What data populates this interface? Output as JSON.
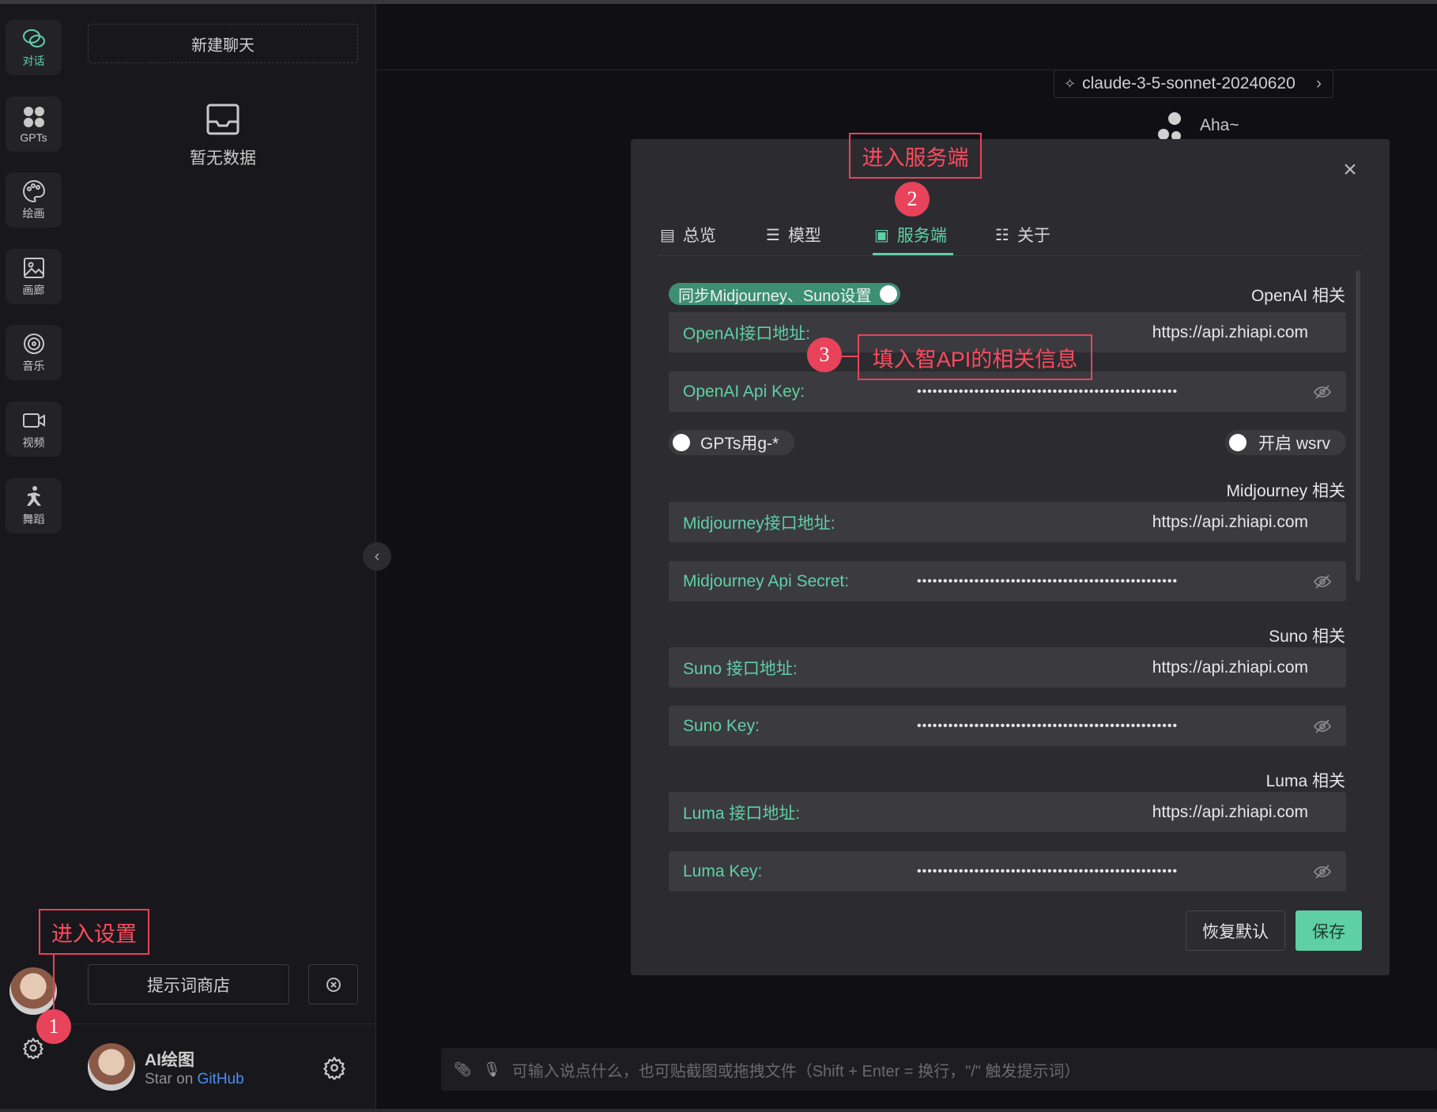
{
  "rail": {
    "items": [
      {
        "label": "对话",
        "icon": "chat-icon"
      },
      {
        "label": "GPTs",
        "icon": "grid-icon"
      },
      {
        "label": "绘画",
        "icon": "palette-icon"
      },
      {
        "label": "画廊",
        "icon": "image-icon"
      },
      {
        "label": "音乐",
        "icon": "music-icon"
      },
      {
        "label": "视频",
        "icon": "video-icon"
      },
      {
        "label": "舞蹈",
        "icon": "dance-icon"
      }
    ]
  },
  "chatlist": {
    "new_chat": "新建聊天",
    "empty_text": "暂无数据",
    "prompt_store": "提示词商店"
  },
  "user": {
    "name": "AI绘图",
    "star_prefix": "Star on",
    "star_link": "GitHub"
  },
  "header": {
    "model": "claude-3-5-sonnet-20240620",
    "assistant_name": "Aha~"
  },
  "input": {
    "placeholder": "可输入说点什么，也可贴截图或拖拽文件（Shift + Enter = 换行，\"/\" 触发提示词）"
  },
  "settings": {
    "tabs": [
      {
        "label": "总览"
      },
      {
        "label": "模型"
      },
      {
        "label": "服务端"
      },
      {
        "label": "关于"
      }
    ],
    "active_tab": "服务端",
    "sync_toggle": "同步Midjourney、Suno设置",
    "gpts_toggle": "GPTs用g-*",
    "wsrv_toggle": "开启 wsrv",
    "sections": {
      "openai": "OpenAI 相关",
      "midjourney": "Midjourney 相关",
      "suno": "Suno 相关",
      "luma": "Luma 相关"
    },
    "fields": {
      "openai_url_label": "OpenAI接口地址:",
      "openai_url_value": "https://api.zhiapi.com",
      "openai_key_label": "OpenAI Api Key:",
      "mj_url_label": "Midjourney接口地址:",
      "mj_url_value": "https://api.zhiapi.com",
      "mj_secret_label": "Midjourney Api Secret:",
      "suno_url_label": "Suno 接口地址:",
      "suno_url_value": "https://api.zhiapi.com",
      "suno_key_label": "Suno Key:",
      "luma_url_label": "Luma 接口地址:",
      "luma_url_value": "https://api.zhiapi.com",
      "luma_key_label": "Luma Key:",
      "masked": "••••••••••••••••••••••••••••••••••••••••••••••••••"
    },
    "reset_button": "恢复默认",
    "save_button": "保存"
  },
  "annotations": {
    "step1_label": "进入设置",
    "step1_num": "1",
    "step2_label": "进入服务端",
    "step2_num": "2",
    "step3_label": "填入智API的相关信息",
    "step3_num": "3"
  },
  "colors": {
    "accent": "#5fd0a6",
    "annotation": "#e8435a",
    "background": "#101014"
  }
}
